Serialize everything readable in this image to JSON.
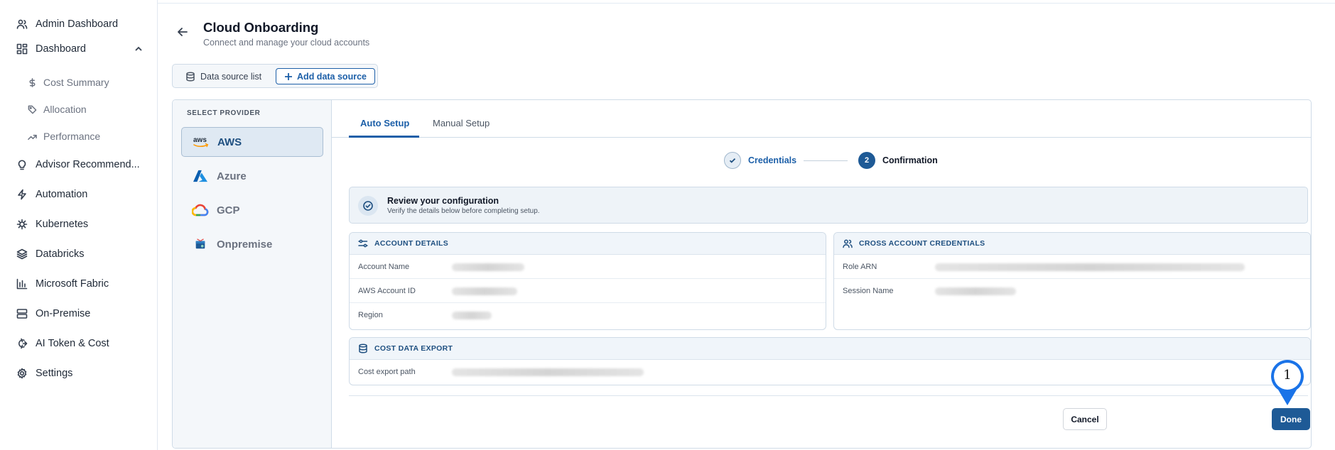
{
  "sidebar": {
    "items": [
      {
        "label": "Admin Dashboard",
        "icon": "users-icon"
      },
      {
        "label": "Dashboard",
        "icon": "grid-icon",
        "expanded": true,
        "children": [
          {
            "label": "Cost Summary",
            "icon": "dollar-icon"
          },
          {
            "label": "Allocation",
            "icon": "tag-icon"
          },
          {
            "label": "Performance",
            "icon": "trend-up-icon"
          }
        ]
      },
      {
        "label": "Advisor Recommend...",
        "icon": "lightbulb-icon"
      },
      {
        "label": "Automation",
        "icon": "zap-icon"
      },
      {
        "label": "Kubernetes",
        "icon": "helm-icon"
      },
      {
        "label": "Databricks",
        "icon": "layers-icon"
      },
      {
        "label": "Microsoft Fabric",
        "icon": "bar-chart-icon"
      },
      {
        "label": "On-Premise",
        "icon": "server-icon"
      },
      {
        "label": "AI Token & Cost",
        "icon": "ai-icon"
      },
      {
        "label": "Settings",
        "icon": "gear-icon"
      }
    ]
  },
  "header": {
    "title": "Cloud Onboarding",
    "subtitle": "Connect and manage your cloud accounts"
  },
  "top_tabs": {
    "list_label": "Data source list",
    "add_label": "Add data source"
  },
  "providers": {
    "heading": "SELECT PROVIDER",
    "items": [
      {
        "label": "AWS",
        "selected": true,
        "logo_text": "aws"
      },
      {
        "label": "Azure",
        "selected": false
      },
      {
        "label": "GCP",
        "selected": false
      },
      {
        "label": "Onpremise",
        "selected": false
      }
    ]
  },
  "setup_tabs": [
    {
      "label": "Auto Setup",
      "active": true
    },
    {
      "label": "Manual Setup",
      "active": false
    }
  ],
  "stepper": {
    "steps": [
      {
        "label": "Credentials",
        "state": "complete"
      },
      {
        "number": "2",
        "label": "Confirmation",
        "state": "current"
      }
    ]
  },
  "review": {
    "title": "Review your configuration",
    "subtitle": "Verify the details below before completing setup."
  },
  "account_details": {
    "heading": "ACCOUNT DETAILS",
    "rows": [
      {
        "label": "Account Name",
        "value_redacted": true
      },
      {
        "label": "AWS Account ID",
        "value_redacted": true
      },
      {
        "label": "Region",
        "value_redacted": true
      }
    ]
  },
  "cross_account": {
    "heading": "CROSS ACCOUNT CREDENTIALS",
    "rows": [
      {
        "label": "Role ARN",
        "value_redacted": true
      },
      {
        "label": "Session Name",
        "value_redacted": true
      }
    ]
  },
  "cost_export": {
    "heading": "COST DATA EXPORT",
    "rows": [
      {
        "label": "Cost export path",
        "value_redacted": true
      }
    ]
  },
  "actions": {
    "cancel_label": "Cancel",
    "done_label": "Done"
  },
  "annotation": {
    "marker_number": "1"
  },
  "colors": {
    "accent": "#1e5a96",
    "link": "#1c5fa8",
    "panel_border": "#cfdbe7",
    "marker": "#1a73e8"
  }
}
